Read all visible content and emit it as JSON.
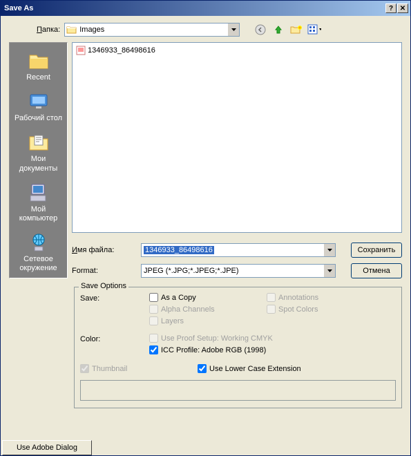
{
  "title": "Save As",
  "folder_label": "Папка:",
  "folder_value": "Images",
  "file_item": "1346933_86498616",
  "places": [
    {
      "label": "Recent"
    },
    {
      "label": "Рабочий стол"
    },
    {
      "label": "Мои документы"
    },
    {
      "label": "Мой компьютер"
    },
    {
      "label": "Сетевое окружение"
    }
  ],
  "filename_label": "Имя файла:",
  "filename_value": "1346933_86498616",
  "format_label": "Format:",
  "format_value": "JPEG (*.JPG;*.JPEG;*.JPE)",
  "save_btn": "Сохранить",
  "cancel_btn": "Отмена",
  "save_options": {
    "legend": "Save Options",
    "save_label": "Save:",
    "as_copy": "As a Copy",
    "alpha": "Alpha Channels",
    "layers": "Layers",
    "annotations": "Annotations",
    "spot": "Spot Colors",
    "color_label": "Color:",
    "proof": "Use Proof Setup:  Working CMYK",
    "icc": "ICC Profile:  Adobe RGB (1998)",
    "thumbnail": "Thumbnail",
    "lowercase": "Use Lower Case Extension"
  },
  "adobe_btn": "Use Adobe Dialog"
}
